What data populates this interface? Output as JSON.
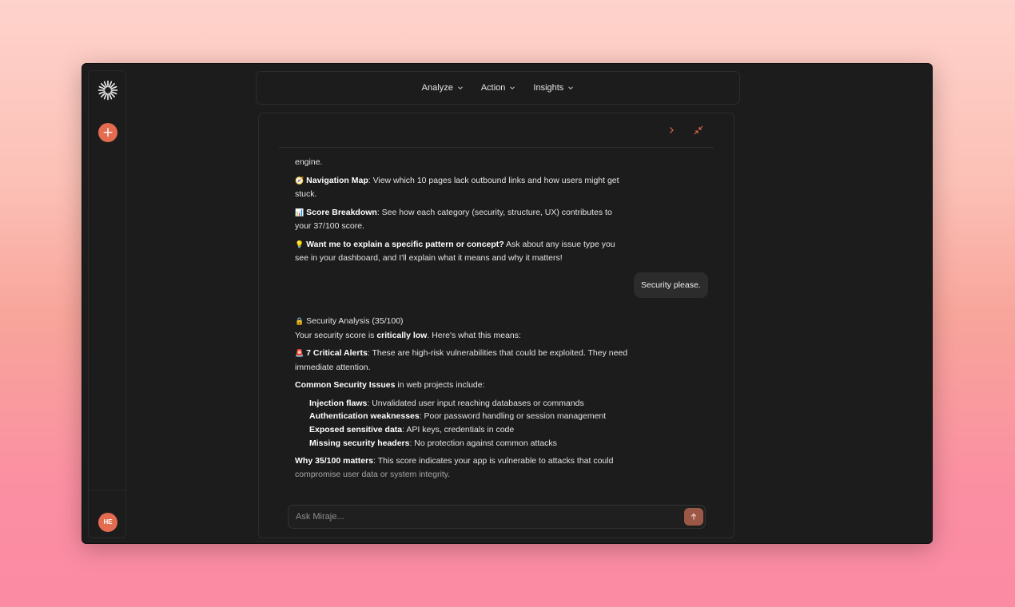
{
  "sidebar": {
    "logo_icon": "sunburst-logo-icon",
    "new_button_label": "+",
    "avatar_initials": "HE",
    "accent_color": "#e36b50"
  },
  "nav": {
    "items": [
      {
        "label": "Analyze",
        "icon": "chevron-down-icon"
      },
      {
        "label": "Action",
        "icon": "chevron-down-icon"
      },
      {
        "label": "Insights",
        "icon": "chevron-down-icon"
      }
    ]
  },
  "panel": {
    "expand_icon": "chevron-right-icon",
    "collapse_icon": "minimize-arrows-icon"
  },
  "messages": {
    "engine_tail": "engine.",
    "nav_map": {
      "emoji": "🧭",
      "bold": "Navigation Map",
      "text": ": View which 10 pages lack outbound links and how users might get stuck."
    },
    "score_breakdown": {
      "emoji": "📊",
      "bold": "Score Breakdown",
      "text": ": See how each category (security, structure, UX) contributes to your 37/100 score."
    },
    "explain": {
      "emoji": "💡",
      "bold": "Want me to explain a specific pattern or concept?",
      "text": " Ask about any issue type you see in your dashboard, and I'll explain what it means and why it matters!"
    },
    "user_message": "Security please.",
    "analysis": {
      "title_emoji": "🔒",
      "title": "Security Analysis (35/100)",
      "score_prefix": "Your security score is ",
      "score_bold": "critically low",
      "score_suffix": ". Here's what this means:",
      "alerts_emoji": "🚨",
      "alerts_bold": "7 Critical Alerts",
      "alerts_text": ": These are high-risk vulnerabilities that could be exploited. They need immediate attention.",
      "common_bold": "Common Security Issues",
      "common_text": " in web projects include:",
      "issues": [
        {
          "bold": "Injection flaws",
          "text": ": Unvalidated user input reaching databases or commands"
        },
        {
          "bold": "Authentication weaknesses",
          "text": ": Poor password handling or session management"
        },
        {
          "bold": "Exposed sensitive data",
          "text": ": API keys, credentials in code"
        },
        {
          "bold": "Missing security headers",
          "text": ": No protection against common attacks"
        }
      ],
      "why_bold": "Why 35/100 matters",
      "why_text": ": This score indicates your app is vulnerable to attacks that could ",
      "why_faded": "compromise user data or system integrity."
    }
  },
  "composer": {
    "placeholder": "Ask Miraje...",
    "value": "",
    "send_icon": "arrow-up-icon"
  }
}
